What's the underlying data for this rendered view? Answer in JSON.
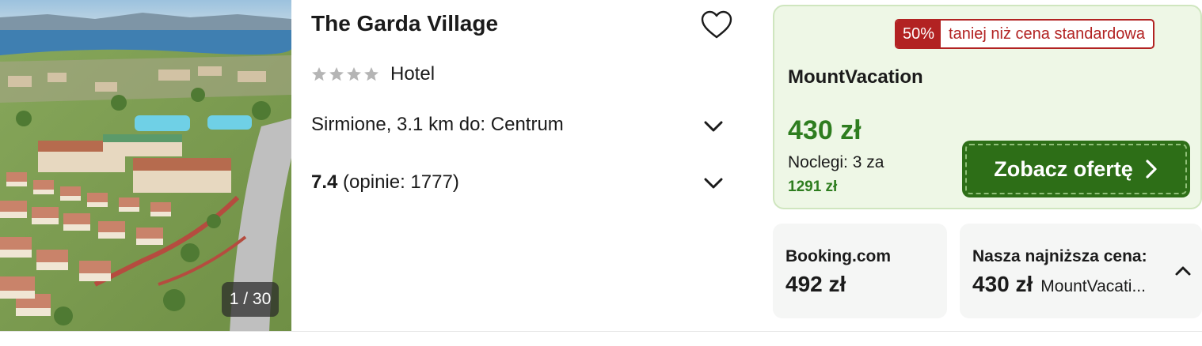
{
  "hotel": {
    "name": "The Garda Village",
    "type": "Hotel",
    "stars": 4,
    "location": "Sirmione, 3.1 km do: Centrum",
    "rating_score": "7.4",
    "rating_reviews": "(opinie: 1777)",
    "photo_counter": "1 / 30"
  },
  "offer": {
    "discount_pct": "50%",
    "discount_text": "taniej niż cena standardowa",
    "provider": "MountVacation",
    "price": "430 zł",
    "nights": "Noclegi: 3 za",
    "total": "1291 zł",
    "cta_label": "Zobacz ofertę"
  },
  "compare": {
    "provider": "Booking.com",
    "price": "492 zł",
    "lowest_label": "Nasza najniższa cena:",
    "lowest_price": "430 zł",
    "lowest_provider": "MountVacati..."
  },
  "icons": {
    "favorite": "heart-outline-icon",
    "expand": "chevron-down-icon",
    "collapse": "chevron-up-icon",
    "cta_arrow": "chevron-right-icon",
    "star": "star-icon"
  },
  "colors": {
    "accent_green": "#2e7d1f",
    "button_green": "#2d6e17",
    "badge_red": "#b22222",
    "offer_bg": "#eef7e6",
    "star_gray": "#b5b5b5"
  }
}
